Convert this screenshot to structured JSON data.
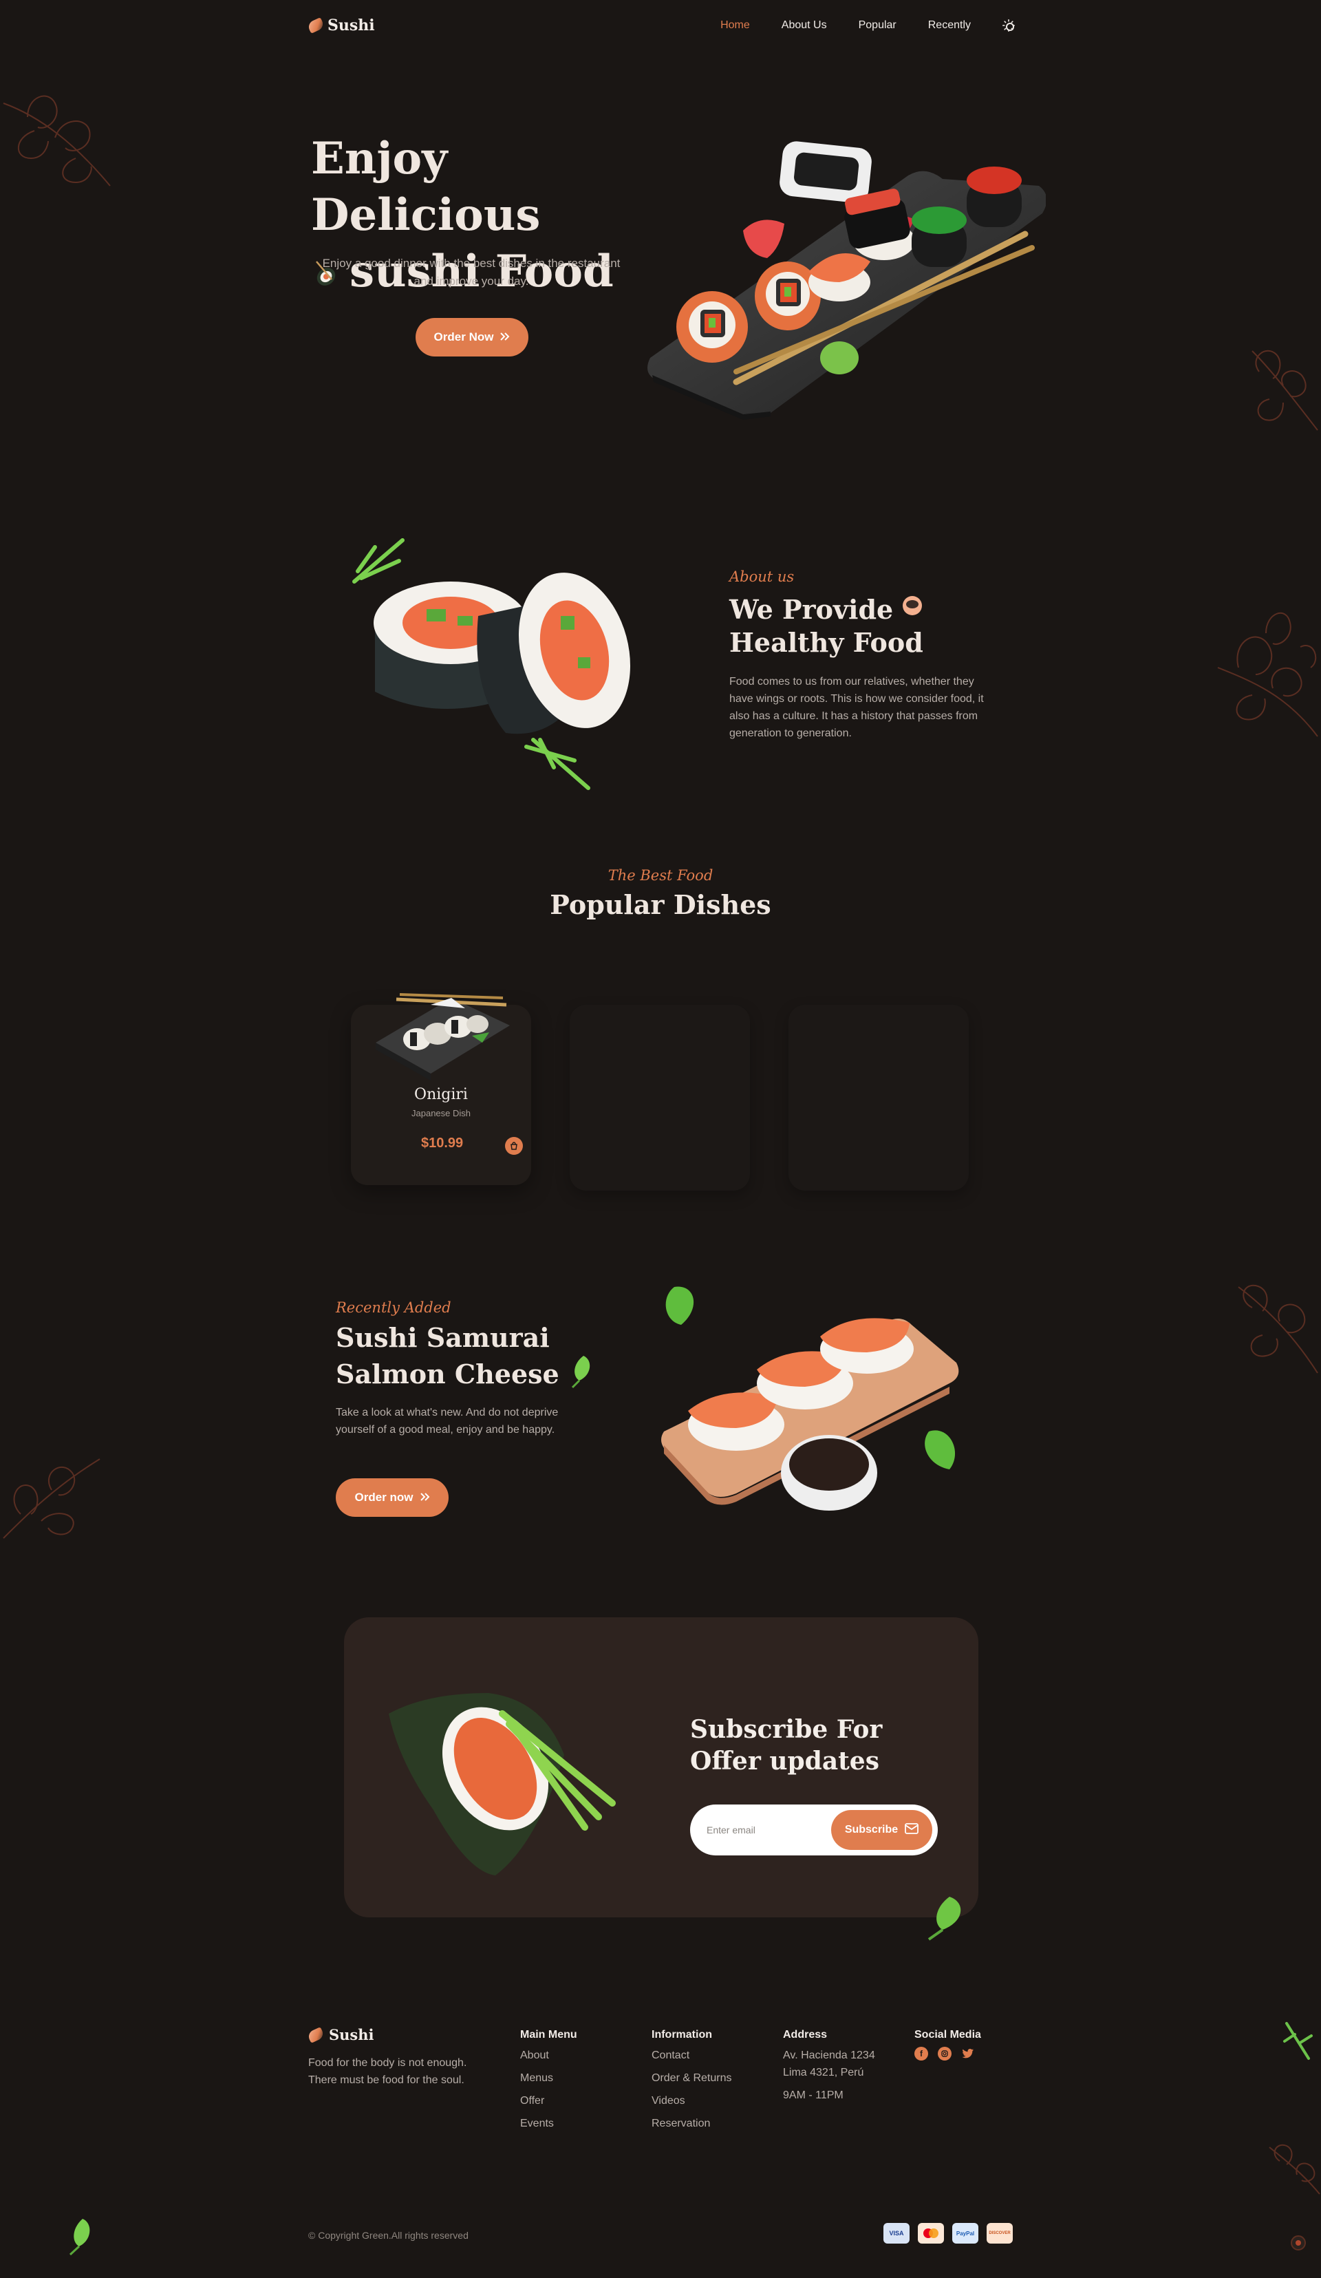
{
  "brand": {
    "name": "Sushi"
  },
  "nav": {
    "items": [
      {
        "label": "Home",
        "active": true
      },
      {
        "label": "About Us",
        "active": false
      },
      {
        "label": "Popular",
        "active": false
      },
      {
        "label": "Recently",
        "active": false
      }
    ],
    "theme_icon": "sun-icon"
  },
  "hero": {
    "title_line1": "Enjoy Delicious",
    "title_line2": "sushi Food",
    "description": "Enjoy a good dinner with the best dishes in the restaurant and improve your day.",
    "button_label": "Order Now"
  },
  "about": {
    "subtitle": "About us",
    "title_line1": "We Provide",
    "title_line2": "Healthy Food",
    "description": "Food comes to us from our relatives, whether they have wings or roots. This is how we consider food, it also has a culture. It has a history that passes from generation to generation."
  },
  "popular": {
    "subtitle": "The Best Food",
    "title": "Popular Dishes",
    "dishes": [
      {
        "name": "Onigiri",
        "desc": "Japanese Dish",
        "price": "$10.99"
      }
    ]
  },
  "recent": {
    "subtitle": "Recently Added",
    "title_line1": "Sushi Samurai",
    "title_line2": "Salmon Cheese",
    "description": "Take a look at what's new. And do not deprive yourself of a good meal, enjoy and be happy.",
    "button_label": "Order now"
  },
  "subscribe": {
    "title_line1": "Subscribe For",
    "title_line2": "Offer updates",
    "placeholder": "Enter email",
    "button_label": "Subscribe"
  },
  "footer": {
    "about": "Food for the body is not enough. There must be food for the soul.",
    "main_menu": {
      "title": "Main Menu",
      "links": [
        "About",
        "Menus",
        "Offer",
        "Events"
      ]
    },
    "information": {
      "title": "Information",
      "links": [
        "Contact",
        "Order & Returns",
        "Videos",
        "Reservation"
      ]
    },
    "address": {
      "title": "Address",
      "line1": "Av. Hacienda 1234",
      "line2": "Lima 4321, Perú",
      "hours": "9AM - 11PM"
    },
    "social": {
      "title": "Social Media",
      "icons": [
        "facebook-icon",
        "instagram-icon",
        "twitter-icon"
      ]
    },
    "copyright": "© Copyright Green.All rights reserved",
    "payments": [
      "VISA",
      "MC",
      "PayPal",
      "DISCOVER"
    ]
  },
  "colors": {
    "accent": "#e07d4e",
    "background": "#1a1614",
    "card": "#211c19",
    "subscribe_bg": "#2e231f"
  }
}
